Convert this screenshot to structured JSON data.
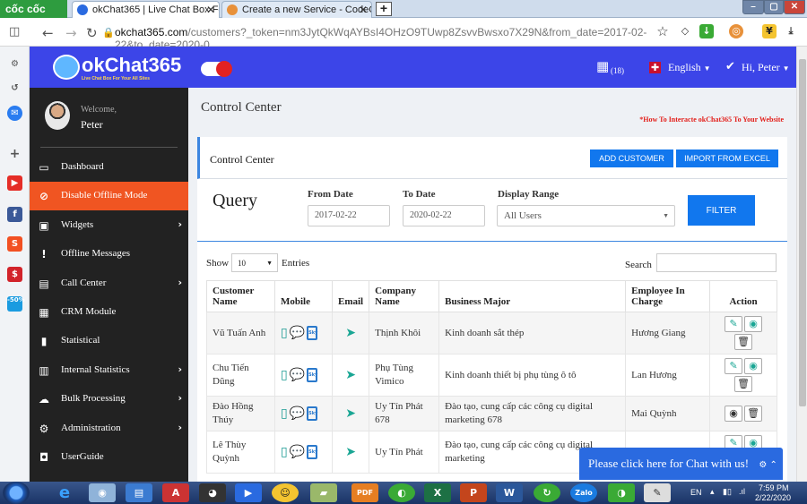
{
  "browser": {
    "brand": "cốc cốc",
    "tabs": [
      {
        "title": "okChat365 | Live Chat Box For"
      },
      {
        "title": "Create a new Service - CodeC"
      }
    ],
    "new_tab": "+",
    "url_domain": "okchat365.com",
    "url_rest": "/customers?_token=nm3JytQkWqAYBsI4OHzO9TUwp8ZsvvBwsxo7X29N&from_date=2017-02-22&to_date=2020-0..."
  },
  "topnav": {
    "logo": "okChat365",
    "logo_slogan": "Live Chat Box For Your All Sites",
    "notif_count": "(18)",
    "language": "English",
    "greeting": "Hi, Peter"
  },
  "sidebar": {
    "welcome": "Welcome,",
    "user": "Peter",
    "items": [
      {
        "label": "Dashboard",
        "icon": "monitor-icon",
        "glyph": "▭",
        "chevron": ""
      },
      {
        "label": "Disable Offline Mode",
        "icon": "ban-icon",
        "glyph": "⊘",
        "chevron": "",
        "active": true
      },
      {
        "label": "Widgets",
        "icon": "window-icon",
        "glyph": "▣",
        "chevron": "›"
      },
      {
        "label": "Offline Messages",
        "icon": "alert-icon",
        "glyph": "!",
        "chevron": ""
      },
      {
        "label": "Call Center",
        "icon": "contact-card-icon",
        "glyph": "▤",
        "chevron": "›"
      },
      {
        "label": "CRM Module",
        "icon": "building-icon",
        "glyph": "▦",
        "chevron": ""
      },
      {
        "label": "Statistical",
        "icon": "bar-chart-icon",
        "glyph": "▮",
        "chevron": ""
      },
      {
        "label": "Internal Statistics",
        "icon": "chart-box-icon",
        "glyph": "▥",
        "chevron": "›"
      },
      {
        "label": "Bulk Processing",
        "icon": "cloud-icon",
        "glyph": "☁",
        "chevron": "›"
      },
      {
        "label": "Administration",
        "icon": "gear-box-icon",
        "glyph": "⚙",
        "chevron": "›"
      },
      {
        "label": "UserGuide",
        "icon": "search-doc-icon",
        "glyph": "◘",
        "chevron": ""
      }
    ]
  },
  "page": {
    "title": "Control Center",
    "howto": "*How To Interacte okChat365 To Your Website",
    "card_title": "Control Center",
    "add_customer": "ADD CUSTOMER",
    "import_excel": "IMPORT FROM EXCEL"
  },
  "query": {
    "title": "Query",
    "from_label": "From Date",
    "from_value": "2017-02-22",
    "to_label": "To Date",
    "to_value": "2020-02-22",
    "range_label": "Display Range",
    "range_value": "All Users",
    "filter": "FILTER"
  },
  "table": {
    "show": "Show",
    "entries_value": "10",
    "entries": "Entries",
    "search": "Search",
    "headers": [
      "Customer Name",
      "Mobile",
      "Email",
      "Company Name",
      "Business Major",
      "Employee In Charge",
      "Action"
    ],
    "rows": [
      {
        "name": "Vũ Tuấn Anh",
        "company": "Thịnh Khôi",
        "major": "Kinh doanh sắt thép",
        "employee": "Hương Giang"
      },
      {
        "name": "Chu Tiến Dũng",
        "company": "Phụ Tùng Vimico",
        "major": "Kinh doanh thiết bị phụ tùng ô tô",
        "employee": "Lan Hương"
      },
      {
        "name": "Đào Hồng Thúy",
        "company": "Uy Tín Phát 678",
        "major": "Đào tạo, cung cấp các công cụ digital marketing 678",
        "employee": "Mai Quỳnh"
      },
      {
        "name": "Lê Thùy Quỳnh",
        "company": "Uy Tín Phát",
        "major": "Đào tạo, cung cấp các công cụ digital marketing",
        "employee": ""
      }
    ]
  },
  "chat": {
    "label": "Please click here for Chat with us!"
  },
  "taskbar": {
    "lang": "EN",
    "time": "7:59 PM",
    "date": "2/22/2020"
  }
}
